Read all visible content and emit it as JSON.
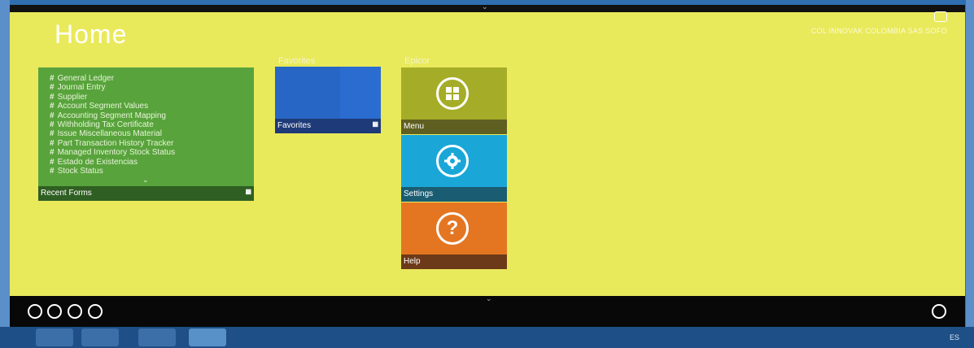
{
  "header": {
    "title": "Home",
    "company": "COL INNOVAK COLOMBIA SAS SOFO"
  },
  "groups": {
    "favorites": "Favorites",
    "epicor": "Epicor"
  },
  "recent": {
    "items": [
      "General Ledger",
      "Journal Entry",
      "Supplier",
      "Account Segment Values",
      "Accounting Segment Mapping",
      "Withholding Tax Certificate",
      "Issue Miscellaneous Material",
      "Part Transaction History Tracker",
      "Managed Inventory Stock Status",
      "Estado de Existencias",
      "Stock Status"
    ],
    "footer_label": "Recent Forms",
    "bullet": "#"
  },
  "tiles": {
    "favorites_label": "Favorites",
    "menu_label": "Menu",
    "settings_label": "Settings",
    "help_label": "Help"
  },
  "taskbar": {
    "lang": "ES"
  },
  "icons": [
    "user-icon",
    "globe-icon",
    "chat-icon",
    "search-icon",
    "apps-icon",
    "menu-grid-icon",
    "gear-icon",
    "question-icon"
  ],
  "colors": {
    "background": "#e9e95c",
    "recent": "#58a33c",
    "favorites": "#2766c4",
    "menu": "#a5ad28",
    "settings": "#1aa7d8",
    "help": "#e47622"
  }
}
